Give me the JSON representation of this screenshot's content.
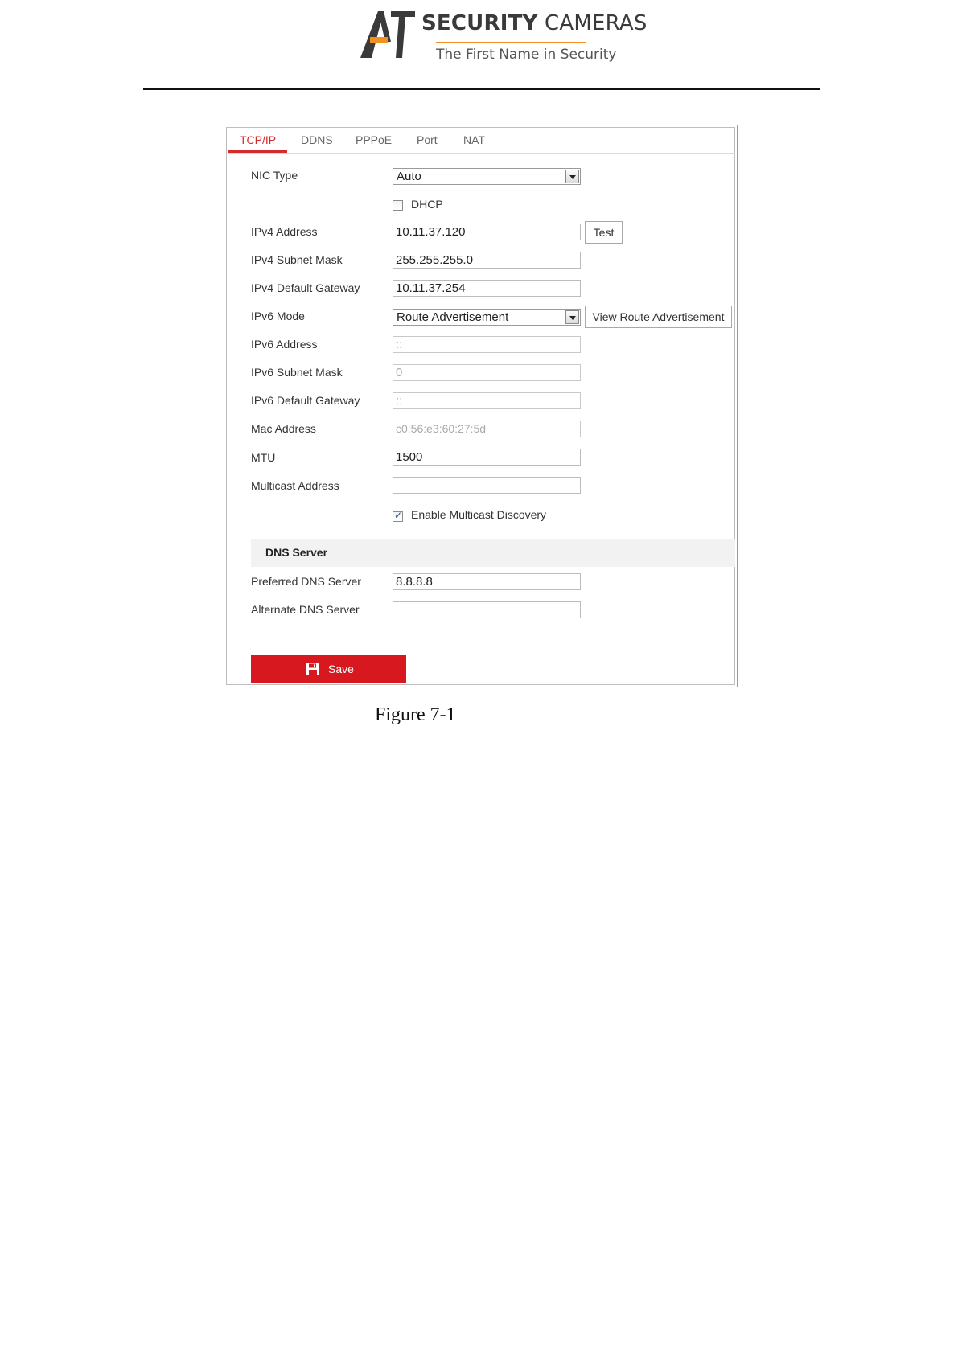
{
  "header": {
    "logo_mark": "A1",
    "title_bold": "SECURITY",
    "title_light": "CAMERAS",
    "tagline": "The First Name in Security",
    "accent_color": "#f29021"
  },
  "tabs": [
    {
      "label": "TCP/IP",
      "active": true
    },
    {
      "label": "DDNS",
      "active": false
    },
    {
      "label": "PPPoE",
      "active": false
    },
    {
      "label": "Port",
      "active": false
    },
    {
      "label": "NAT",
      "active": false
    }
  ],
  "form": {
    "nic_type": {
      "label": "NIC Type",
      "value": "Auto"
    },
    "dhcp": {
      "label": "DHCP",
      "checked": false
    },
    "ipv4_address": {
      "label": "IPv4 Address",
      "value": "10.11.37.120"
    },
    "test_button": "Test",
    "ipv4_subnet": {
      "label": "IPv4 Subnet Mask",
      "value": "255.255.255.0"
    },
    "ipv4_gateway": {
      "label": "IPv4 Default Gateway",
      "value": "10.11.37.254"
    },
    "ipv6_mode": {
      "label": "IPv6 Mode",
      "value": "Route Advertisement"
    },
    "view_route_button": "View Route Advertisement",
    "ipv6_address": {
      "label": "IPv6 Address",
      "value": "::"
    },
    "ipv6_subnet": {
      "label": "IPv6 Subnet Mask",
      "value": "0"
    },
    "ipv6_gateway": {
      "label": "IPv6 Default Gateway",
      "value": "::"
    },
    "mac_address": {
      "label": "Mac Address",
      "value": "c0:56:e3:60:27:5d"
    },
    "mtu": {
      "label": "MTU",
      "value": "1500"
    },
    "multicast_address": {
      "label": "Multicast Address",
      "value": ""
    },
    "multicast_discovery": {
      "label": "Enable Multicast Discovery",
      "checked": true
    }
  },
  "dns": {
    "section_title": "DNS Server",
    "preferred": {
      "label": "Preferred DNS Server",
      "value": "8.8.8.8"
    },
    "alternate": {
      "label": "Alternate DNS Server",
      "value": ""
    }
  },
  "save_button": {
    "label": "Save",
    "icon": "save-icon",
    "color": "#d7191f"
  },
  "caption": "Figure 7-1",
  "colors": {
    "active_tab": "#d42b2b",
    "section_band": "#f2f2f2"
  }
}
